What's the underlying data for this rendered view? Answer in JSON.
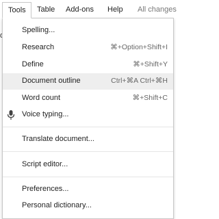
{
  "menubar": {
    "tools": "Tools",
    "table": "Table",
    "addons": "Add-ons",
    "help": "Help",
    "changes": "All changes"
  },
  "edge_fragment": "d",
  "menu": {
    "items": [
      {
        "label": "Spelling...",
        "shortcut": ""
      },
      {
        "label": "Research",
        "shortcut": "⌘+Option+Shift+I"
      },
      {
        "label": "Define",
        "shortcut": "⌘+Shift+Y"
      },
      {
        "label": "Document outline",
        "shortcut": "Ctrl+⌘A Ctrl+⌘H",
        "highlighted": true
      },
      {
        "label": "Word count",
        "shortcut": "⌘+Shift+C"
      },
      {
        "label": "Voice typing...",
        "shortcut": "",
        "icon": "microphone-icon"
      },
      {
        "label": "Translate document...",
        "shortcut": ""
      },
      {
        "label": "Script editor...",
        "shortcut": ""
      },
      {
        "label": "Preferences...",
        "shortcut": ""
      },
      {
        "label": "Personal dictionary...",
        "shortcut": ""
      }
    ]
  },
  "colors": {
    "highlight": "#eeeeee",
    "border": "#c8c8c8",
    "shortcut_text": "#666666"
  }
}
